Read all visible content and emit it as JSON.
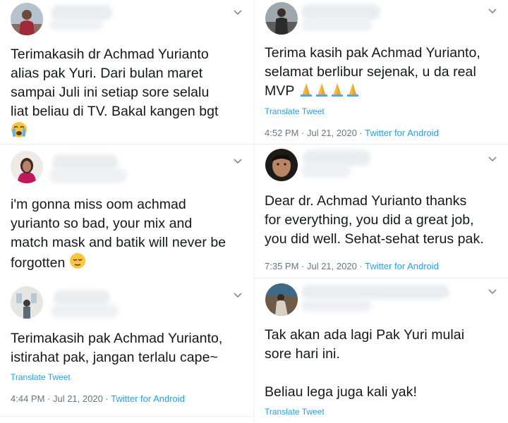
{
  "left": {
    "tweets": [
      {
        "text_lines": [
          "Terimakasih dr Achmad Yurianto",
          "alias pak Yuri. Dari bulan maret",
          "sampai Juli ini setiap sore selalu",
          "liat beliau di TV. Bakal kangen bgt"
        ],
        "avatar_icon": "avatar-person-icon",
        "emoji_icon": "loudly-crying-face-icon"
      },
      {
        "text_lines": [
          "i'm gonna miss oom achmad",
          "yurianto so bad, your mix and",
          "match mask and batik will never be",
          "forgotten"
        ],
        "avatar_icon": "avatar-person-icon",
        "emoji_icon": "relieved-face-icon"
      },
      {
        "text_lines": [
          "Terimakasih pak Achmad Yurianto,",
          "istirahat pak, jangan terlalu cape~"
        ],
        "translate": "Translate Tweet",
        "timestamp": "4:44 PM · Jul 21, 2020 · ",
        "source": "Twitter for Android",
        "avatar_icon": "avatar-person-icon"
      }
    ]
  },
  "right": {
    "tweets": [
      {
        "text_lines": [
          "Terima kasih pak Achmad Yurianto,",
          "selamat berlibur sejenak, u da real",
          "MVP"
        ],
        "translate": "Translate Tweet",
        "timestamp": "4:52 PM · Jul 21, 2020 · ",
        "source": "Twitter for Android",
        "avatar_icon": "avatar-person-icon",
        "emoji_icon": "folded-hands-icon"
      },
      {
        "text_lines": [
          "Dear dr. Achmad Yurianto thanks",
          "for everything, you did a great job,",
          "you did well. Sehat-sehat terus pak."
        ],
        "timestamp": "7:35 PM · Jul 21, 2020 · ",
        "source": "Twitter for Android",
        "avatar_icon": "avatar-person-icon"
      },
      {
        "text_lines": [
          "Tak akan ada lagi Pak Yuri mulai",
          "sore hari ini.",
          "",
          "Beliau lega juga kali yak!"
        ],
        "translate": "Translate Tweet",
        "avatar_icon": "avatar-person-icon"
      }
    ]
  },
  "colors": {
    "text": "#14171a",
    "link": "#1da1f2",
    "meta": "#657786",
    "blur": "#e8ecef"
  }
}
